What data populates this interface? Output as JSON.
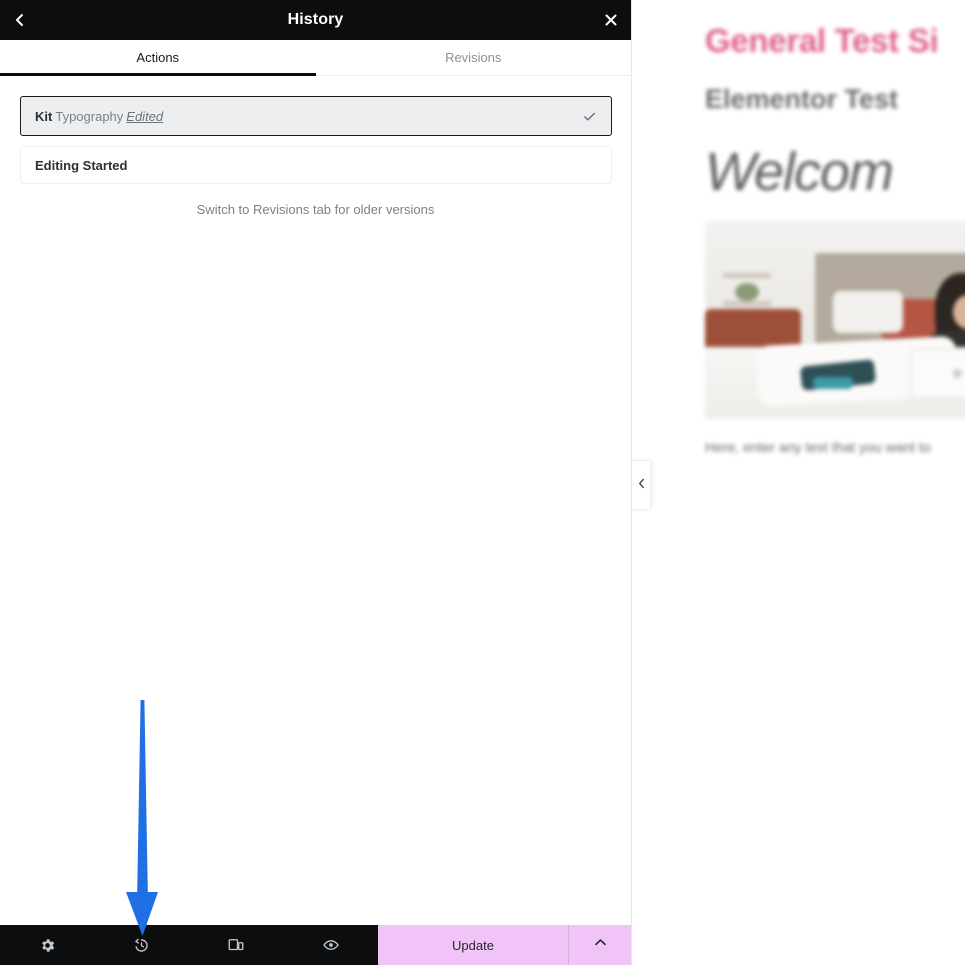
{
  "panel": {
    "header": {
      "title": "History",
      "back_icon": "chevron-left-icon",
      "close_icon": "close-icon"
    },
    "tabs": [
      {
        "label": "Actions",
        "active": true
      },
      {
        "label": "Revisions",
        "active": false
      }
    ],
    "history": {
      "items": [
        {
          "title": "Kit",
          "subtitle": "Typography",
          "action": "Edited",
          "current": true,
          "check_icon": "check-icon"
        },
        {
          "title": "Editing Started",
          "subtitle": "",
          "action": "",
          "current": false
        }
      ],
      "note": "Switch to Revisions tab for older versions"
    },
    "footer": {
      "tools": [
        {
          "name": "settings-icon",
          "label": "Settings"
        },
        {
          "name": "history-icon",
          "label": "History"
        },
        {
          "name": "responsive-icon",
          "label": "Responsive Mode"
        },
        {
          "name": "preview-icon",
          "label": "Preview Changes"
        }
      ],
      "update_label": "Update",
      "update_caret_icon": "chevron-up-icon",
      "update_color": "#F1C4F7"
    },
    "collapse_handle_icon": "chevron-left-icon"
  },
  "preview": {
    "site_title": "General Test Si",
    "tagline": "Elementor Test",
    "heading": "Welcom",
    "body_text": "Here, enter any text that you want to",
    "site_title_color": "#E0628C",
    "image_alt": "woman working on laptop in bed"
  },
  "annotation": {
    "arrow_color": "#1f6fe5",
    "points_to": "history-icon"
  }
}
